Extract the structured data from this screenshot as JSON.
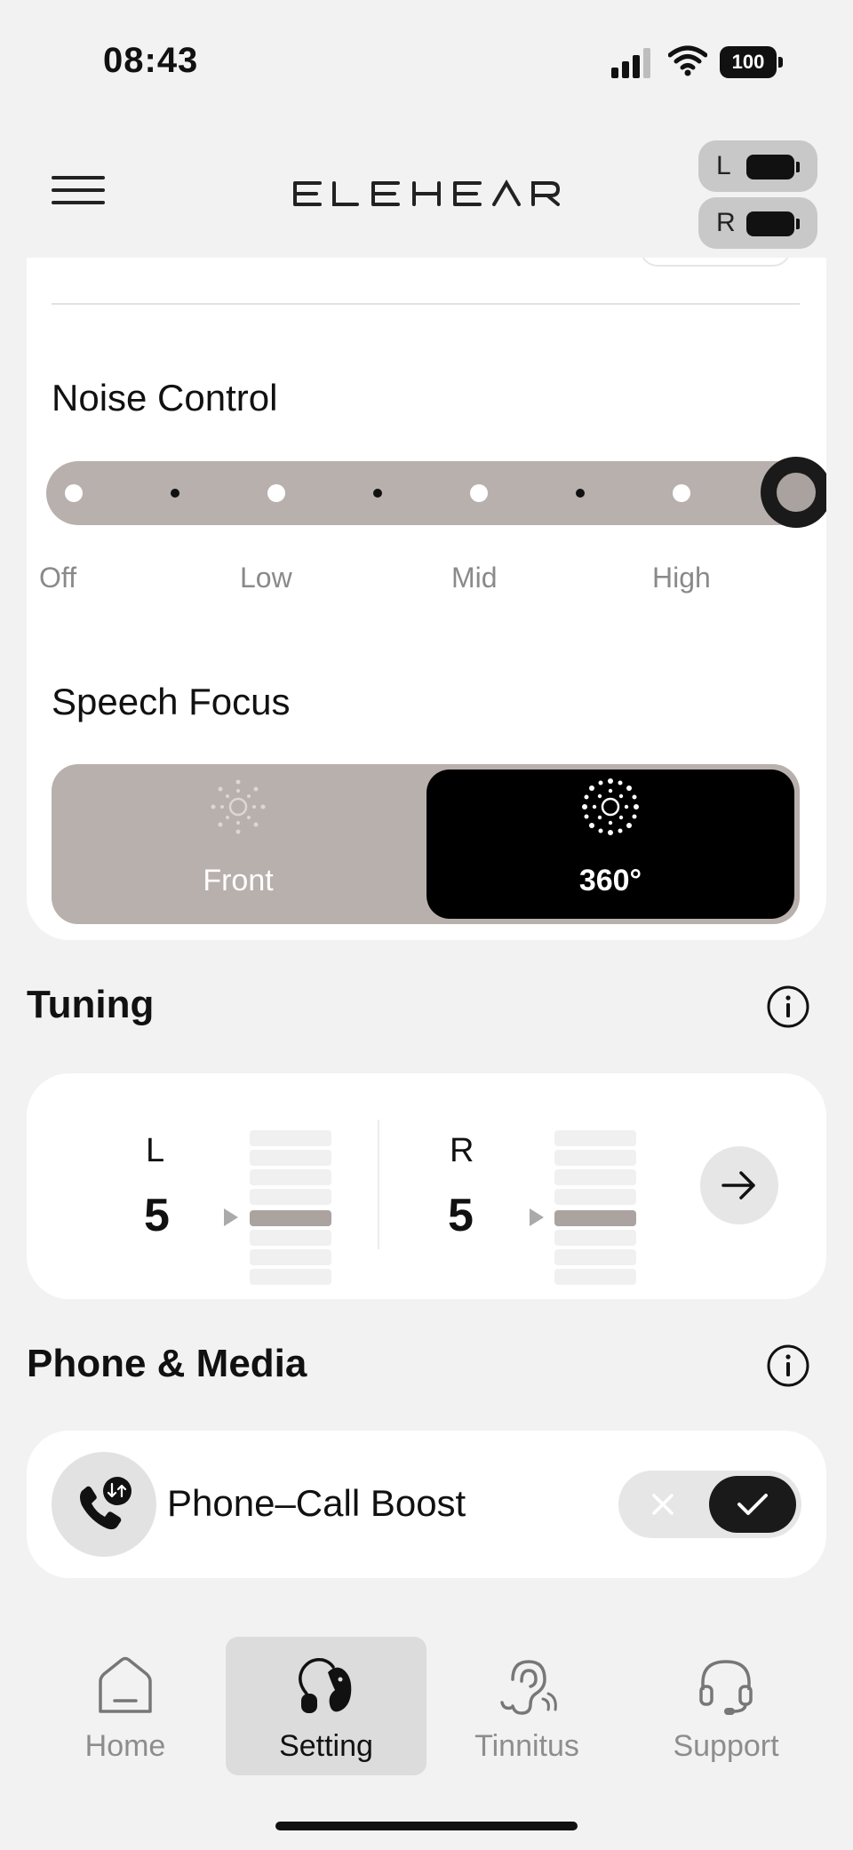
{
  "status_bar": {
    "time": "08:43",
    "battery": "100",
    "icons": [
      "signal-icon",
      "wifi-icon",
      "battery-icon"
    ]
  },
  "header": {
    "logo": "ELEHEAR",
    "menu_icon": "hamburger-menu-icon",
    "ears": [
      {
        "letter": "L",
        "battery_icon": "battery-icon"
      },
      {
        "letter": "R",
        "battery_icon": "battery-icon"
      }
    ]
  },
  "noise_control": {
    "title": "Noise Control",
    "labels": [
      "Off",
      "Low",
      "Mid",
      "High"
    ],
    "steps": 8,
    "selected_step": 8
  },
  "speech_focus": {
    "title": "Speech Focus",
    "options": [
      {
        "label": "Front",
        "icon": "front-focus-icon",
        "selected": false
      },
      {
        "label": "360°",
        "icon": "360-focus-icon",
        "selected": true
      }
    ]
  },
  "tuning": {
    "title": "Tuning",
    "info_icon": "info-icon",
    "left": {
      "ear": "L",
      "value": "5"
    },
    "right": {
      "ear": "R",
      "value": "5"
    },
    "scale_levels": 8,
    "action_icon": "arrow-right-icon"
  },
  "phone_media": {
    "title": "Phone & Media",
    "info_icon": "info-icon",
    "phone_call_boost": {
      "label": "Phone–Call Boost",
      "icon": "phone-boost-icon",
      "enabled": true
    }
  },
  "tabbar": {
    "tabs": [
      {
        "label": "Home",
        "icon": "home-icon",
        "active": false
      },
      {
        "label": "Setting",
        "icon": "hearing-aid-icon",
        "active": true
      },
      {
        "label": "Tinnitus",
        "icon": "ear-icon",
        "active": false
      },
      {
        "label": "Support",
        "icon": "headset-icon",
        "active": false
      }
    ]
  },
  "colors": {
    "accent_dark": "#111111",
    "track": "#b8b0ad",
    "background": "#f2f2f2",
    "card": "#ffffff"
  }
}
